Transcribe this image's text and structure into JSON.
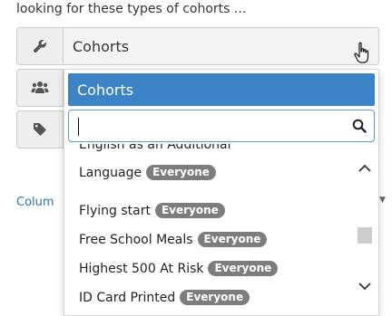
{
  "intro_text": "looking for these types of cohorts ...",
  "select": {
    "value": "Cohorts"
  },
  "column_label": "Colum",
  "dropdown": {
    "selected": "Cohorts",
    "search_value": "",
    "options": [
      {
        "label": "English as an Additional",
        "badge": ""
      },
      {
        "label": "Language",
        "badge": "Everyone"
      },
      {
        "label": "Flying start",
        "badge": "Everyone"
      },
      {
        "label": "Free School Meals",
        "badge": "Everyone"
      },
      {
        "label": "Highest 500 At Risk",
        "badge": "Everyone"
      },
      {
        "label": "ID Card Printed",
        "badge": "Everyone"
      }
    ]
  },
  "colors": {
    "accent": "#3d83c8",
    "badge": "#7d7d7d",
    "link": "#2b78b5"
  },
  "icons": {
    "row1": "wrench-icon",
    "row2": "users-icon",
    "row3": "tag-icon"
  }
}
